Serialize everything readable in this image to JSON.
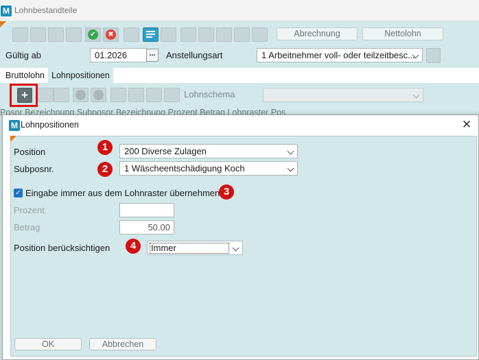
{
  "window": {
    "title": "Lohnbestandteile",
    "logo_letter": "M"
  },
  "toolbar": {
    "abrechnung_label": "Abrechnung",
    "nettolohn_label": "Nettolohn",
    "ok_icon_glyph": "✔",
    "cancel_icon_glyph": "✖",
    "accent_green": "#36a64f",
    "accent_red": "#e0443a"
  },
  "form": {
    "gueltig_ab_label": "Gültig ab",
    "gueltig_ab_value": "01.2026",
    "dots_label": "...",
    "anstellungsart_label": "Anstellungsart",
    "anstellungsart_value": "1 Arbeitnehmer voll- oder teilzeitbesc..."
  },
  "tabs": [
    {
      "label": "Bruttolohn",
      "selected": false
    },
    {
      "label": "Lohnpositionen",
      "selected": true
    }
  ],
  "subtoolbar": {
    "add_glyph": "+",
    "lohnschema_label": "Lohnschema"
  },
  "grid_header_text": "Posnr        Bezeichnung              Subposnr   Bezeichnung                Prozent        Betrag          Lohnraster     Pos",
  "dialog": {
    "title": "Lohnpositionen",
    "logo_letter": "M",
    "close_glyph": "✕",
    "position_label": "Position",
    "position_value": "200 Diverse Zulagen",
    "subposnr_label": "Subposnr.",
    "subposnr_value": "1 Wäscheentschädigung Koch",
    "checkbox_label": "Eingabe immer aus dem Lohnraster übernehmen",
    "checkbox_checked": true,
    "check_glyph": "✓",
    "prozent_label": "Prozent",
    "prozent_value": "",
    "betrag_label": "Betrag",
    "betrag_value": "50.00",
    "beruecksichtigen_label": "Position berücksichtigen",
    "beruecksichtigen_value": "Immer",
    "ok_label": "OK",
    "abbrechen_label": "Abbrechen"
  },
  "annotations": {
    "n1": "1",
    "n2": "2",
    "n3": "3",
    "n4": "4",
    "highlight_color": "#e01010"
  }
}
